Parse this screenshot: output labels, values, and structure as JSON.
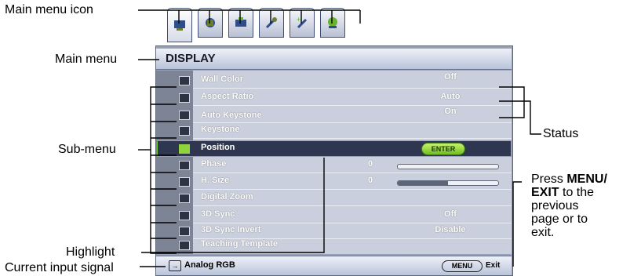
{
  "callouts": {
    "main_menu_icon": "Main menu icon",
    "main_menu": "Main menu",
    "sub_menu": "Sub-menu",
    "highlight": "Highlight",
    "current_input_signal": "Current input signal",
    "status": "Status",
    "press_prefix": "Press ",
    "press_menu": "MENU/",
    "press_exit": "EXIT",
    "press_suffix_1": " to the",
    "press_suffix_2": "previous",
    "press_suffix_3": "page or to",
    "press_suffix_4": "exit."
  },
  "osd": {
    "tabs": [
      "display-icon",
      "picture-icon",
      "source-icon",
      "system-setup-basic-icon",
      "system-setup-advanced-icon",
      "information-icon"
    ],
    "title": "DISPLAY",
    "items": [
      {
        "label": "Wall Color",
        "value": "Off"
      },
      {
        "label": "Aspect Ratio",
        "value": "Auto"
      },
      {
        "label": "Auto Keystone",
        "value": "On"
      },
      {
        "label": "Keystone",
        "value": ""
      },
      {
        "label": "Position",
        "value": "ENTER"
      },
      {
        "label": "Phase",
        "value": "0",
        "level": 0.0
      },
      {
        "label": "H. Size",
        "value": "0",
        "level": 0.5
      },
      {
        "label": "Digital Zoom",
        "value": ""
      },
      {
        "label": "3D Sync",
        "value": "Off"
      },
      {
        "label": "3D Sync Invert",
        "value": "Disable"
      },
      {
        "label": "Teaching Template",
        "value": ""
      }
    ],
    "footer": {
      "source": "Analog RGB",
      "menu_button": "MENU",
      "exit": "Exit"
    }
  },
  "colors": {
    "highlight_border": "#6fcc2a",
    "enter_button": "#8fd43a"
  }
}
